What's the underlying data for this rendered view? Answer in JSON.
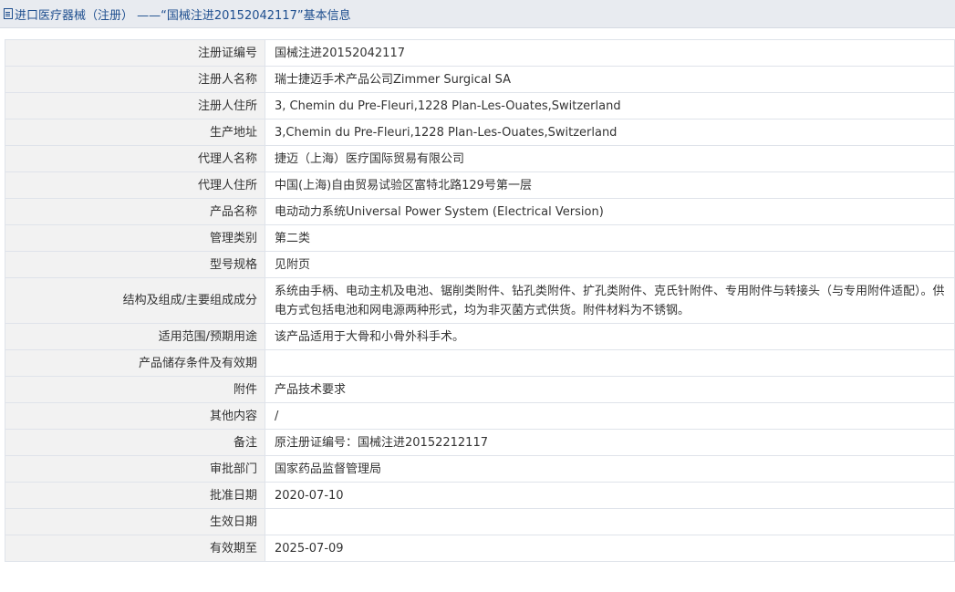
{
  "header": {
    "title": "进口医疗器械（注册） ——“国械注进20152042117”基本信息"
  },
  "rows": [
    {
      "label": "注册证编号",
      "value": "国械注进20152042117"
    },
    {
      "label": "注册人名称",
      "value": "瑞士捷迈手术产品公司Zimmer Surgical SA"
    },
    {
      "label": "注册人住所",
      "value": "3, Chemin du Pre-Fleuri,1228 Plan-Les-Ouates,Switzerland"
    },
    {
      "label": "生产地址",
      "value": "3,Chemin du Pre-Fleuri,1228 Plan-Les-Ouates,Switzerland"
    },
    {
      "label": "代理人名称",
      "value": "捷迈（上海）医疗国际贸易有限公司"
    },
    {
      "label": "代理人住所",
      "value": "中国(上海)自由贸易试验区富特北路129号第一层"
    },
    {
      "label": "产品名称",
      "value": "电动动力系统Universal Power System (Electrical Version)"
    },
    {
      "label": "管理类别",
      "value": "第二类"
    },
    {
      "label": "型号规格",
      "value": "见附页"
    },
    {
      "label": "结构及组成/主要组成成分",
      "value": "系统由手柄、电动主机及电池、锯削类附件、钻孔类附件、扩孔类附件、克氏针附件、专用附件与转接头（与专用附件适配）。供电方式包括电池和网电源两种形式，均为非灭菌方式供货。附件材料为不锈钢。"
    },
    {
      "label": "适用范围/预期用途",
      "value": "该产品适用于大骨和小骨外科手术。"
    },
    {
      "label": "产品储存条件及有效期",
      "value": ""
    },
    {
      "label": "附件",
      "value": "产品技术要求"
    },
    {
      "label": "其他内容",
      "value": "/"
    },
    {
      "label": "备注",
      "value": "原注册证编号：国械注进20152212117"
    },
    {
      "label": "审批部门",
      "value": "国家药品监督管理局"
    },
    {
      "label": "批准日期",
      "value": "2020-07-10"
    },
    {
      "label": "生效日期",
      "value": ""
    },
    {
      "label": "有效期至",
      "value": "2025-07-09"
    }
  ]
}
